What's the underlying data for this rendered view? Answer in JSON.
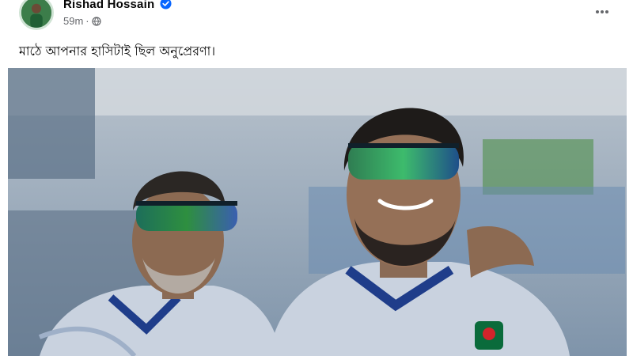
{
  "post": {
    "author_name": "Rishad Hossain",
    "time": "59m",
    "separator": "·",
    "text": "মাঠে আপনার হাসিটাই ছিল অনুপ্রেরণা।",
    "more_label": "•••"
  },
  "icons": {
    "avatar": "profile-avatar",
    "verified": "verified-badge-icon",
    "audience": "globe-icon",
    "more": "more-options-icon"
  },
  "colors": {
    "verified_blue": "#0866ff",
    "meta_gray": "#65676b",
    "text": "#050505",
    "jersey": "#c9d2df",
    "jersey_trim": "#1f3d8a"
  }
}
